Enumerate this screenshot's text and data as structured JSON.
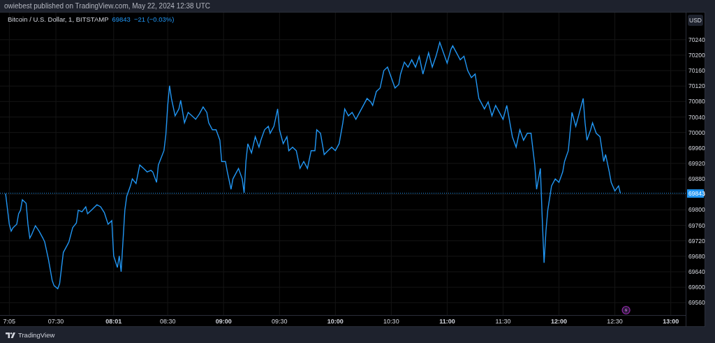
{
  "header": {
    "text": "owiebest published on TradingView.com, May 22, 2024 12:38 UTC"
  },
  "legend": {
    "symbol": "Bitcoin / U.S. Dollar, 1, BITSTAMP",
    "price": "69843",
    "change": "−21 (−0.03%)"
  },
  "currency_button": {
    "label": "USD"
  },
  "chart": {
    "chart_data": {
      "type": "line",
      "xlim": [
        420,
        788
      ],
      "ylim": [
        69528,
        70310
      ],
      "xticks": [
        {
          "value": 425,
          "label": "7:05"
        },
        {
          "value": 450,
          "label": "07:30"
        },
        {
          "value": 481,
          "label": "**08:01**"
        },
        {
          "value": 510,
          "label": "08:30"
        },
        {
          "value": 540,
          "label": "**09:00**"
        },
        {
          "value": 570,
          "label": "09:30"
        },
        {
          "value": 600,
          "label": "**10:00**"
        },
        {
          "value": 630,
          "label": "10:30"
        },
        {
          "value": 660,
          "label": "**11:00**"
        },
        {
          "value": 690,
          "label": "11:30"
        },
        {
          "value": 720,
          "label": "**12:00**"
        },
        {
          "value": 750,
          "label": "12:30"
        },
        {
          "value": 780,
          "label": "**13:00**"
        }
      ],
      "yticks": [
        69560,
        69600,
        69640,
        69680,
        69720,
        69760,
        69800,
        69840,
        69880,
        69920,
        69960,
        70000,
        70040,
        70080,
        70120,
        70160,
        70200,
        70240
      ],
      "x": [
        423,
        425,
        426,
        427,
        429,
        430,
        431,
        432,
        434,
        435,
        436,
        437,
        439,
        441,
        443,
        444,
        446,
        448,
        449,
        451,
        452,
        454,
        456,
        457,
        459,
        461,
        462,
        464,
        466,
        467,
        469,
        472,
        474,
        476,
        478,
        480,
        481,
        483,
        484,
        485,
        487,
        488,
        490,
        491,
        493,
        495,
        497,
        499,
        501,
        502,
        504,
        505,
        508,
        509,
        510,
        511,
        512,
        514,
        516,
        517,
        519,
        521,
        523,
        525,
        527,
        529,
        531,
        532,
        534,
        536,
        538,
        539,
        541,
        542,
        544,
        545,
        547,
        548,
        550,
        551,
        552,
        553,
        555,
        557,
        559,
        560,
        562,
        564,
        565,
        567,
        569,
        570,
        572,
        574,
        575,
        577,
        579,
        581,
        583,
        585,
        587,
        589,
        590,
        592,
        594,
        596,
        598,
        600,
        602,
        604,
        605,
        607,
        609,
        611,
        613,
        615,
        617,
        619,
        620,
        622,
        624,
        626,
        628,
        630,
        632,
        634,
        635,
        637,
        639,
        641,
        643,
        645,
        647,
        648,
        650,
        652,
        654,
        656,
        658,
        660,
        662,
        663,
        665,
        667,
        669,
        671,
        673,
        675,
        677,
        678,
        680,
        682,
        684,
        686,
        688,
        690,
        692,
        693,
        695,
        697,
        699,
        701,
        703,
        705,
        707,
        708,
        710,
        711,
        712,
        713,
        714,
        716,
        718,
        720,
        722,
        723,
        725,
        727,
        729,
        731,
        733,
        734,
        735,
        737,
        738,
        740,
        742,
        744,
        745,
        747,
        748,
        750,
        752,
        753
      ],
      "series": [
        {
          "color": "#2196f3",
          "values": [
            69842,
            69763,
            69745,
            69754,
            69763,
            69790,
            69799,
            69826,
            69817,
            69763,
            69727,
            69736,
            69759,
            69745,
            69727,
            69717,
            69672,
            69618,
            69604,
            69596,
            69609,
            69690,
            69708,
            69717,
            69754,
            69766,
            69799,
            69795,
            69808,
            69790,
            69799,
            69813,
            69808,
            69793,
            69763,
            69772,
            69681,
            69651,
            69681,
            69640,
            69799,
            69835,
            69862,
            69880,
            69868,
            69916,
            69907,
            69898,
            69902,
            69898,
            69871,
            69916,
            69953,
            69994,
            70070,
            70121,
            70088,
            70043,
            70061,
            70083,
            70025,
            70052,
            70043,
            70034,
            70048,
            70066,
            70052,
            70025,
            70007,
            70007,
            69980,
            69925,
            69925,
            69898,
            69853,
            69880,
            69898,
            69907,
            69880,
            69844,
            69925,
            69971,
            69947,
            69989,
            69962,
            69980,
            70007,
            70016,
            69998,
            70016,
            70061,
            70007,
            69971,
            69989,
            69953,
            69962,
            69953,
            69907,
            69925,
            69907,
            69953,
            69953,
            70007,
            69998,
            69943,
            69953,
            69962,
            69953,
            69971,
            70025,
            70061,
            70043,
            70052,
            70034,
            70052,
            70070,
            70088,
            70079,
            70070,
            70106,
            70115,
            70160,
            70169,
            70142,
            70115,
            70124,
            70151,
            70182,
            70169,
            70188,
            70169,
            70197,
            70151,
            70169,
            70206,
            70169,
            70197,
            70233,
            70206,
            70179,
            70215,
            70224,
            70206,
            70188,
            70197,
            70160,
            70142,
            70151,
            70088,
            70079,
            70061,
            70079,
            70043,
            70070,
            70052,
            70034,
            70070,
            70043,
            69989,
            69962,
            70007,
            69980,
            69998,
            69998,
            69916,
            69853,
            69907,
            69781,
            69663,
            69745,
            69799,
            69862,
            69880,
            69871,
            69898,
            69925,
            69953,
            70052,
            70016,
            70052,
            70088,
            70025,
            69980,
            70007,
            70025,
            69998,
            69989,
            69925,
            69943,
            69898,
            69871,
            69849,
            69862,
            69842
          ]
        }
      ],
      "grid": true,
      "ref_lines": [
        {
          "axis": "y",
          "value": 69843,
          "label": "69843"
        }
      ]
    }
  },
  "footer": {
    "logo_text": "TradingView"
  }
}
